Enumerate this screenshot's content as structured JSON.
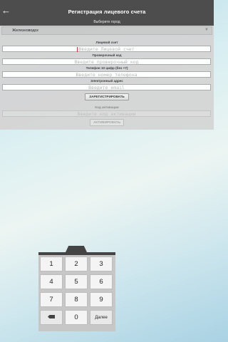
{
  "header": {
    "title": "Регистрация лицевого счета",
    "back_icon": "arrow-left-icon",
    "city_prompt": "Выберите город"
  },
  "city": {
    "selected": "Железноводск",
    "arrow_icon": "dropdown-arrow-icon"
  },
  "form": {
    "account_label": "Лицевой счет",
    "account_placeholder": "Введите Лицевой счет",
    "check_label": "Проверочный код",
    "check_placeholder": "Введите проверочный код",
    "phone_label": "Телефон 10 цифр (без +7)",
    "phone_placeholder": "Введите номер телефона",
    "email_label": "Электронный адрес",
    "email_placeholder": "Введите email",
    "register_button": "ЗАРЕГИСТРИРОВАТЬ",
    "activation_label": "Код активации",
    "activation_placeholder": "Введите код активации",
    "activate_button": "АКТИВИРОВАТЬ"
  },
  "keypad": {
    "keys": [
      "1",
      "2",
      "3",
      "4",
      "5",
      "6",
      "7",
      "8",
      "9",
      "0"
    ],
    "backspace_icon": "backspace-icon",
    "next_label": "Далее"
  }
}
